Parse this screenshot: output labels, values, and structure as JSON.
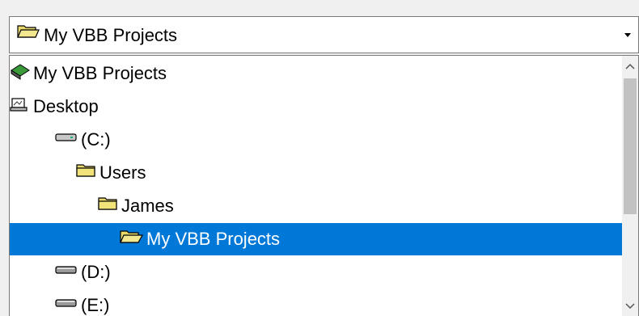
{
  "combo": {
    "selected_label": "My VBB Projects",
    "icon": "open-folder-icon"
  },
  "dropdown": {
    "items": [
      {
        "label": "My VBB Projects",
        "icon": "user-home-icon",
        "indent": 0,
        "selected": false
      },
      {
        "label": "Desktop",
        "icon": "desktop-icon",
        "indent": 0,
        "selected": false
      },
      {
        "label": "(C:)",
        "icon": "hard-drive-icon",
        "indent": 1,
        "selected": false
      },
      {
        "label": "Users",
        "icon": "folder-icon",
        "indent": 2,
        "selected": false
      },
      {
        "label": "James",
        "icon": "folder-icon",
        "indent": 3,
        "selected": false
      },
      {
        "label": "My VBB Projects",
        "icon": "open-folder-icon",
        "indent": 4,
        "selected": true
      },
      {
        "label": "(D:)",
        "icon": "drive-icon",
        "indent": 1,
        "selected": false
      },
      {
        "label": "(E:)",
        "icon": "drive-icon",
        "indent": 1,
        "selected": false
      }
    ]
  },
  "colors": {
    "selection": "#0078d7",
    "folder": "#e8d86a"
  }
}
